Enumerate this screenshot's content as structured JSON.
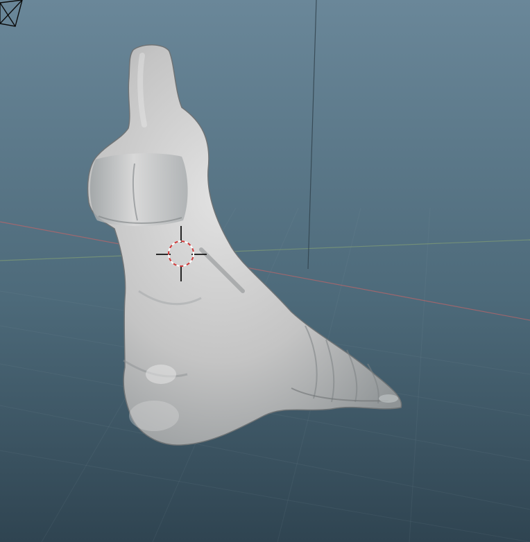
{
  "viewport": {
    "background_top": "#6a8799",
    "background_bottom": "#2f4451",
    "grid_color": "#8fa6b3",
    "x_axis_color": "#b8656a",
    "y_axis_color": "#7e9a76",
    "z_axis_color": "#31434d"
  },
  "model": {
    "name": "sculpted-foot-mesh",
    "base_color": "#c4c4c4",
    "highlight_color": "#e2e2e2",
    "shadow_color": "#6f7375"
  },
  "cursor_3d": {
    "ring_color_a": "#ffffff",
    "ring_color_b": "#d23a3a",
    "crosshair_color": "#111111"
  },
  "camera_gizmo": {
    "icon": "camera-wireframe-icon",
    "color": "#0a0a0a"
  }
}
